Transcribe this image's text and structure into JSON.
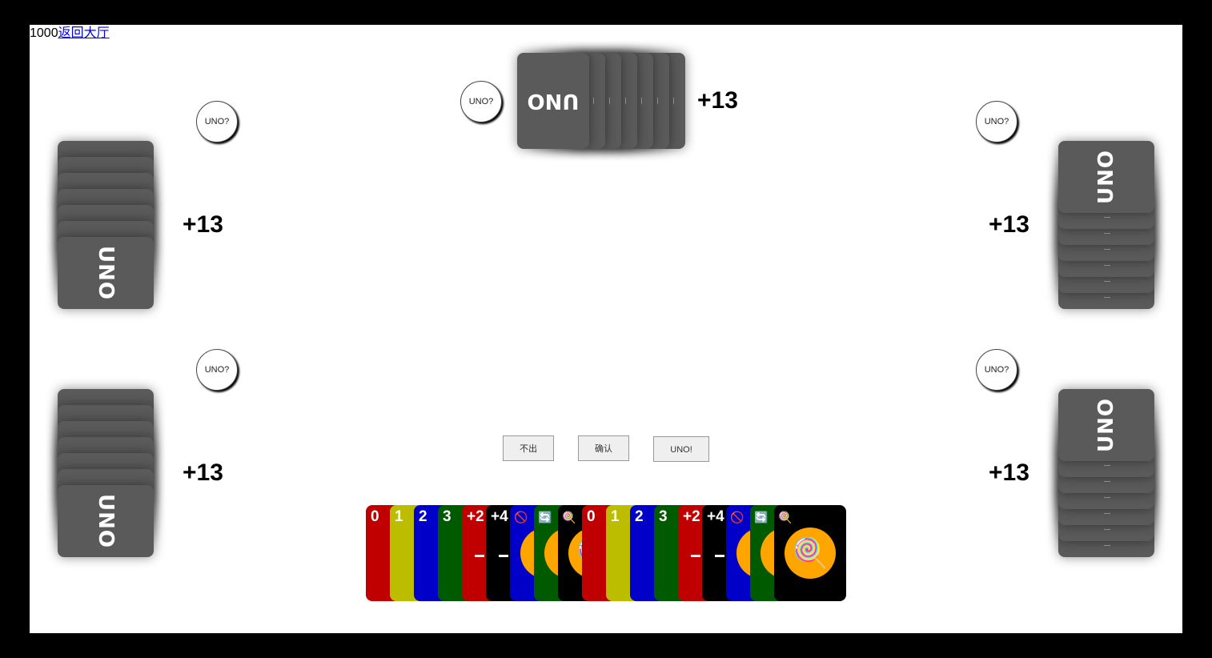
{
  "topbar": {
    "score": "1000",
    "back_link": "返回大厅"
  },
  "opponents": {
    "top": {
      "uno_label": "UNO?",
      "count": "+13",
      "brand": "UNO"
    },
    "left_upper": {
      "uno_label": "UNO?",
      "count": "+13",
      "brand": "UNO"
    },
    "left_lower": {
      "uno_label": "UNO?",
      "count": "+13",
      "brand": "UNO"
    },
    "right_upper": {
      "uno_label": "UNO?",
      "count": "+13",
      "brand": "UNO"
    },
    "right_lower": {
      "uno_label": "UNO?",
      "count": "+13",
      "brand": "UNO"
    }
  },
  "actions": {
    "pass": "不出",
    "confirm": "确认",
    "uno": "UNO!"
  },
  "colors": {
    "red": "#c00000",
    "yellow": "#bdbd00",
    "blue": "#0000c8",
    "green": "#005a00",
    "black": "#000000",
    "wild_circle": "#ffa500",
    "card_back": "#5a5a5a"
  },
  "hand": [
    {
      "label": "0",
      "color": "red"
    },
    {
      "label": "1",
      "color": "yellow"
    },
    {
      "label": "2",
      "color": "blue"
    },
    {
      "label": "3",
      "color": "green"
    },
    {
      "label": "+2",
      "color": "red"
    },
    {
      "label": "+4",
      "color": "black"
    },
    {
      "icon": "skip-icon",
      "color": "blue"
    },
    {
      "icon": "reverse-icon",
      "color": "green"
    },
    {
      "icon": "wild-icon",
      "color": "black"
    },
    {
      "label": "0",
      "color": "red"
    },
    {
      "label": "1",
      "color": "yellow"
    },
    {
      "label": "2",
      "color": "blue"
    },
    {
      "label": "3",
      "color": "green"
    },
    {
      "label": "+2",
      "color": "red"
    },
    {
      "label": "+4",
      "color": "black"
    },
    {
      "icon": "skip-icon",
      "color": "blue"
    },
    {
      "icon": "reverse-icon",
      "color": "green"
    },
    {
      "icon": "wild-icon",
      "color": "black"
    }
  ]
}
